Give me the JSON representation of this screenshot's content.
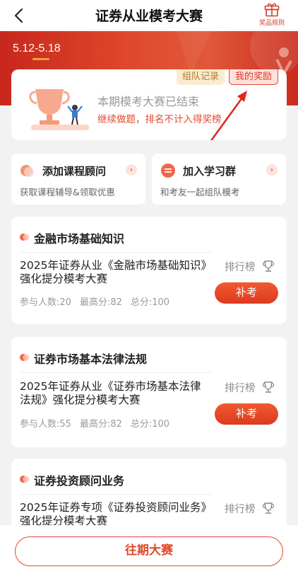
{
  "header": {
    "title": "证券从业模考大赛",
    "rules_label": "奖品规则"
  },
  "banner": {
    "date_range": "5.12-5.18"
  },
  "hero": {
    "team_record_label": "组队记录",
    "my_reward_label": "我的奖励",
    "ended_text": "本期模考大赛已结束",
    "note_text": "继续做题，排名不计入得奖榜"
  },
  "quick_links": [
    {
      "title": "添加课程顾问",
      "subtitle": "获取课程辅导&领取优惠"
    },
    {
      "title": "加入学习群",
      "subtitle": "和考友一起组队模考"
    }
  ],
  "contests": [
    {
      "subject": "金融市场基础知识",
      "name": "2025年证券从业《金融市场基础知识》强化提分模考大赛",
      "participants": "参与人数:20",
      "max_score": "最高分:82",
      "total_score": "总分:100",
      "rank_label": "排行榜",
      "action_label": "补考"
    },
    {
      "subject": "证券市场基本法律法规",
      "name": "2025年证券从业《证券市场基本法律法规》强化提分模考大赛",
      "participants": "参与人数:55",
      "max_score": "最高分:82",
      "total_score": "总分:100",
      "rank_label": "排行榜",
      "action_label": "补考"
    },
    {
      "subject": "证券投资顾问业务",
      "name": "2025年证券专项《证券投资顾问业务》强化提分模考大赛",
      "rank_label": "排行榜"
    }
  ],
  "footer": {
    "past_label": "往期大赛"
  },
  "colors": {
    "accent": "#e04a2c",
    "banner": "#d93d24",
    "tag_gold": "#b07a2a"
  },
  "icons": [
    "back-arrow-icon",
    "gift-icon",
    "trophy-icon",
    "chevron-right-icon",
    "bullet-dot-icon"
  ]
}
